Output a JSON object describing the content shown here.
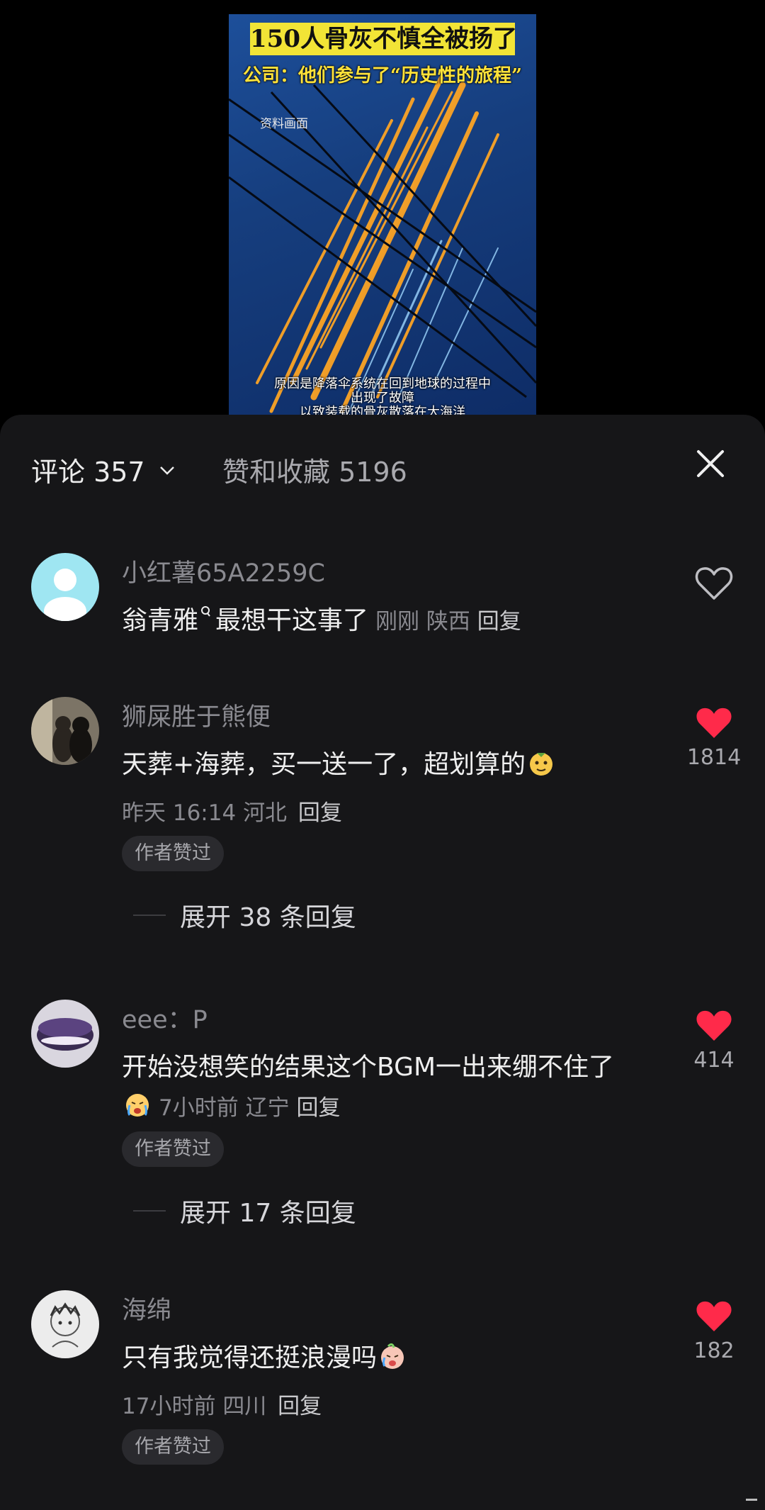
{
  "video": {
    "caption_main": "150人骨灰不慎全被扬了",
    "caption_quote": "公司：他们参与了“历史性的旅程”",
    "watermark": "资料画面",
    "subtitle_line1": "原因是降落伞系统在回到地球的过程中",
    "subtitle_line2": "出现了故障",
    "subtitle_line3": "以致装载的骨灰散落在大海洋"
  },
  "header": {
    "comments_label": "评论 357",
    "likes_collects_label": "赞和收藏 5196"
  },
  "comments": [
    {
      "user": "小红薯65A2259C",
      "mention": "翁青雅",
      "text": "最想干这事了",
      "time": "刚刚",
      "location": "陕西",
      "reply": "回复",
      "liked": false
    },
    {
      "user": "狮屎胜于熊便",
      "text": "天葬+海葬，买一送一了，超划算的",
      "time": "昨天 16:14",
      "location": "河北",
      "reply": "回复",
      "liked": true,
      "likes": "1814",
      "badge": "作者赞过",
      "expand": "展开 38 条回复"
    },
    {
      "user": "eee：P",
      "text": "开始没想笑的结果这个BGM一出来绷不住了",
      "time": "7小时前",
      "location": "辽宁",
      "reply": "回复",
      "liked": true,
      "likes": "414",
      "badge": "作者赞过",
      "expand": "展开 17 条回复"
    },
    {
      "user": "海绵",
      "text": "只有我觉得还挺浪漫吗",
      "time": "17小时前",
      "location": "四川",
      "reply": "回复",
      "liked": true,
      "likes": "182",
      "badge": "作者赞过"
    }
  ],
  "colors": {
    "panel_bg": "#161618",
    "like_red": "#ff2a4a",
    "caption_yellow": "#f2e436"
  }
}
